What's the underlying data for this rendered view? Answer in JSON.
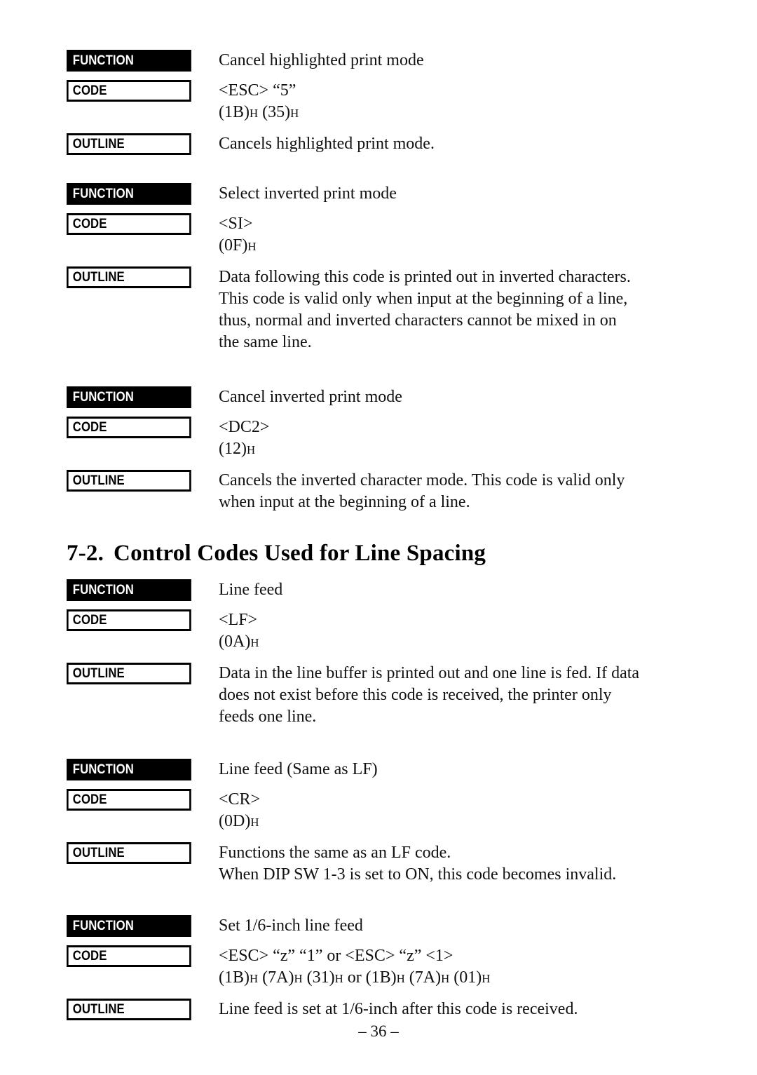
{
  "page": {
    "number_label": "– 36 –",
    "labels": {
      "function": "FUNCTION",
      "code": "CODE",
      "outline": "OUTLINE"
    }
  },
  "section": {
    "number": "7-2.",
    "title": "Control Codes Used for Line Spacing"
  },
  "blocks": [
    {
      "id": "cancel-highlighted-print-mode",
      "function": "Cancel highlighted print mode",
      "code_line1": "<ESC> “5”",
      "code_hex_pre": "(1B)",
      "code_hex_h1": "H",
      "code_hex_mid": " (35)",
      "code_hex_h2": "H",
      "outline_lines": [
        "Cancels highlighted print mode."
      ]
    },
    {
      "id": "select-inverted-print-mode",
      "function": "Select inverted print mode",
      "code_line1": "<SI>",
      "code_hex_pre": "(0F)",
      "code_hex_h1": "H",
      "code_hex_mid": "",
      "code_hex_h2": "",
      "outline_lines": [
        "Data following this code is printed out in inverted characters.",
        "This code is valid only when input at the beginning of a line,",
        "thus, normal and inverted characters cannot be mixed in on",
        "the same line."
      ]
    },
    {
      "id": "cancel-inverted-print-mode",
      "function": "Cancel inverted print mode",
      "code_line1": "<DC2>",
      "code_hex_pre": "(12)",
      "code_hex_h1": "H",
      "code_hex_mid": "",
      "code_hex_h2": "",
      "outline_lines": [
        "Cancels the inverted character mode. This code is valid only",
        "when input at the beginning of a line."
      ]
    },
    {
      "id": "line-feed",
      "function": "Line feed",
      "code_line1": "<LF>",
      "code_hex_pre": "(0A)",
      "code_hex_h1": "H",
      "code_hex_mid": "",
      "code_hex_h2": "",
      "outline_lines": [
        "Data in the line buffer is printed out and one line is fed. If data",
        "does not exist before this code is received, the printer only",
        "feeds one line."
      ]
    },
    {
      "id": "line-feed-same-as-lf",
      "function": "Line feed (Same as LF)",
      "code_line1": "<CR>",
      "code_hex_pre": "(0D)",
      "code_hex_h1": "H",
      "code_hex_mid": "",
      "code_hex_h2": "",
      "outline_lines": [
        "Functions the same as an LF code.",
        "When DIP SW 1-3 is set to ON, this code becomes invalid."
      ]
    },
    {
      "id": "set-one-sixth-inch-line-feed",
      "function": "Set 1/6-inch line feed",
      "code_line1": "<ESC> “z” “1” or <ESC> “z” <1>",
      "code_hex_pre": "(1B)",
      "code_hex_h1": "H",
      "code_hex_mid": " (7A)",
      "code_hex_h2": "H",
      "code_hex_rest": " (31)",
      "code_hex_h3": "H",
      "code_hex_rest2": " or (1B)",
      "code_hex_h4": "H",
      "code_hex_rest3": " (7A)",
      "code_hex_h5": "H",
      "code_hex_rest4": " (01)",
      "code_hex_h6": "H",
      "outline_lines": [
        "Line feed is set at 1/6-inch after this code is received."
      ]
    }
  ]
}
